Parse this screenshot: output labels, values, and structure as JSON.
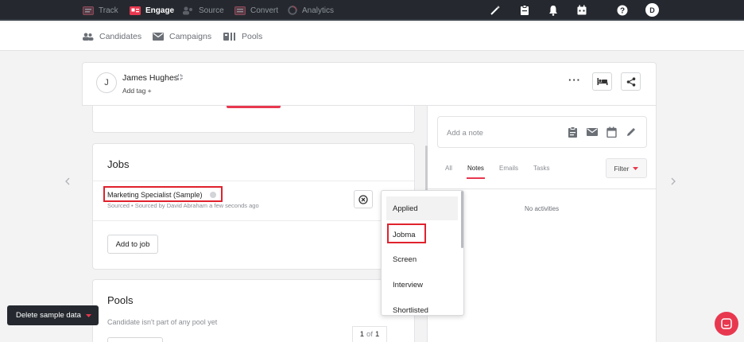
{
  "topnav": {
    "items": [
      {
        "label": "Track",
        "icon": "track-icon"
      },
      {
        "label": "Engage",
        "icon": "engage-icon"
      },
      {
        "label": "Source",
        "icon": "source-icon"
      },
      {
        "label": "Convert",
        "icon": "convert-icon"
      },
      {
        "label": "Analytics",
        "icon": "analytics-icon"
      }
    ],
    "active": "Engage",
    "user_initial": "D"
  },
  "subnav": {
    "items": [
      {
        "label": "Candidates",
        "icon": "people-icon"
      },
      {
        "label": "Campaigns",
        "icon": "mail-icon"
      },
      {
        "label": "Pools",
        "icon": "pools-icon"
      }
    ]
  },
  "candidate": {
    "initial": "J",
    "name": "James Hughes",
    "add_tag": "Add tag +"
  },
  "jobs": {
    "title": "Jobs",
    "job_title": "Marketing Specialist (Sample)",
    "job_meta": "Sourced • Sourced by David Abraham a few seconds ago",
    "add_to_job": "Add to job"
  },
  "stage_dropdown": {
    "options": [
      "Applied",
      "Jobma",
      "Screen",
      "Interview",
      "Shortlisted"
    ],
    "hovered": "Applied",
    "highlighted": "Jobma"
  },
  "pools": {
    "title": "Pools",
    "message": "Candidate isn't part of any pool yet"
  },
  "activity": {
    "note_placeholder": "Add a note",
    "tabs": [
      "All",
      "Notes",
      "Emails",
      "Tasks"
    ],
    "active_tab": "Notes",
    "filter_label": "Filter",
    "empty_message": "No activities"
  },
  "pager": {
    "current": "1",
    "of_label": "of",
    "total": "1"
  },
  "delete_sample": "Delete sample data",
  "colors": {
    "accent": "#e8384f",
    "nav_bg": "#25292f",
    "highlight_box": "#e0222d"
  }
}
